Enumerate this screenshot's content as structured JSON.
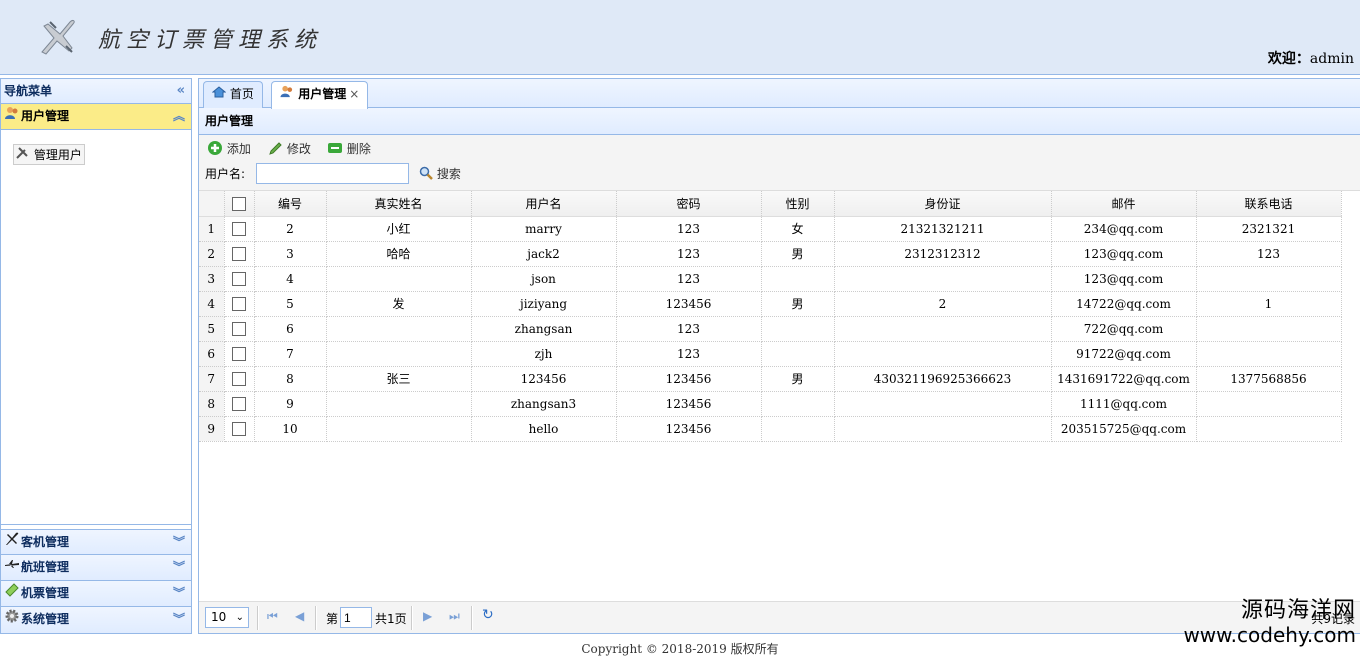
{
  "header": {
    "app_title": "航空订票管理系统",
    "welcome_label": "欢迎：",
    "username": "admin"
  },
  "sidebar": {
    "title": "导航菜单",
    "sections": [
      {
        "label": "用户管理",
        "icon": "users-icon",
        "expanded": true,
        "items": [
          {
            "label": "管理用户",
            "icon": "tools-icon"
          }
        ]
      },
      {
        "label": "客机管理",
        "icon": "airplane-icon",
        "expanded": false
      },
      {
        "label": "航班管理",
        "icon": "flight-icon",
        "expanded": false
      },
      {
        "label": "机票管理",
        "icon": "ticket-icon",
        "expanded": false
      },
      {
        "label": "系统管理",
        "icon": "gear-icon",
        "expanded": false
      }
    ]
  },
  "tabs": [
    {
      "label": "首页",
      "icon": "home-icon",
      "active": false
    },
    {
      "label": "用户管理",
      "icon": "users-icon",
      "active": true,
      "closable": true,
      "close": "×"
    }
  ],
  "grid": {
    "title": "用户管理",
    "toolbar": {
      "add": "添加",
      "edit": "修改",
      "delete": "删除"
    },
    "search": {
      "label": "用户名:",
      "value": "",
      "button": "搜索"
    },
    "columns": [
      "编号",
      "真实姓名",
      "用户名",
      "密码",
      "性别",
      "身份证",
      "邮件",
      "联系电话"
    ],
    "rows": [
      {
        "rn": "1",
        "id": "2",
        "realname": "小红",
        "username": "marry",
        "password": "123",
        "gender": "女",
        "idcard": "21321321211",
        "email": "234@qq.com",
        "phone": "2321321"
      },
      {
        "rn": "2",
        "id": "3",
        "realname": "哈哈",
        "username": "jack2",
        "password": "123",
        "gender": "男",
        "idcard": "2312312312",
        "email": "123@qq.com",
        "phone": "123"
      },
      {
        "rn": "3",
        "id": "4",
        "realname": "",
        "username": "json",
        "password": "123",
        "gender": "",
        "idcard": "",
        "email": "123@qq.com",
        "phone": ""
      },
      {
        "rn": "4",
        "id": "5",
        "realname": "发",
        "username": "jiziyang",
        "password": "123456",
        "gender": "男",
        "idcard": "2",
        "email": "14722@qq.com",
        "phone": "1"
      },
      {
        "rn": "5",
        "id": "6",
        "realname": "",
        "username": "zhangsan",
        "password": "123",
        "gender": "",
        "idcard": "",
        "email": "722@qq.com",
        "phone": ""
      },
      {
        "rn": "6",
        "id": "7",
        "realname": "",
        "username": "zjh",
        "password": "123",
        "gender": "",
        "idcard": "",
        "email": "91722@qq.com",
        "phone": ""
      },
      {
        "rn": "7",
        "id": "8",
        "realname": "张三",
        "username": "123456",
        "password": "123456",
        "gender": "男",
        "idcard": "430321196925366623",
        "email": "1431691722@qq.com",
        "phone": "1377568856"
      },
      {
        "rn": "8",
        "id": "9",
        "realname": "",
        "username": "zhangsan3",
        "password": "123456",
        "gender": "",
        "idcard": "",
        "email": "1111@qq.com",
        "phone": ""
      },
      {
        "rn": "9",
        "id": "10",
        "realname": "",
        "username": "hello",
        "password": "123456",
        "gender": "",
        "idcard": "",
        "email": "203515725@qq.com",
        "phone": ""
      }
    ]
  },
  "pager": {
    "page_size": "10",
    "page_prefix": "第",
    "page_value": "1",
    "page_total": "共1页",
    "summary": "共9记录"
  },
  "footer": {
    "copyright": "Copyright © 2018-2019 版权所有"
  },
  "watermark": {
    "line1": "源码海洋网",
    "line2": "www.codehy.com"
  }
}
